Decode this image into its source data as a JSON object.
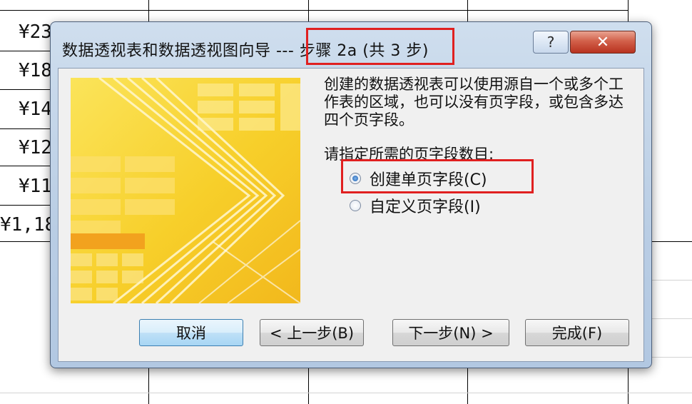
{
  "sheet": {
    "cells": [
      "¥23",
      "¥18",
      "¥14",
      "¥12",
      "¥11",
      "¥1,18"
    ]
  },
  "dialog": {
    "title_prefix": "数据透视表和数据透视图向导 --- ",
    "title_step": "步骤 2a (共 3 步)",
    "help_glyph": "?",
    "close_glyph": "✕",
    "description": "创建的数据透视表可以使用源自一个或多个工作表的区域，也可以没有页字段，或包含多达四个页字段。",
    "prompt": "请指定所需的页字段数目:",
    "options": [
      {
        "label": "创建单页字段(C)",
        "selected": true
      },
      {
        "label": "自定义页字段(I)",
        "selected": false
      }
    ],
    "buttons": {
      "cancel": "取消",
      "back": "< 上一步(B)",
      "next": "下一步(N) >",
      "finish": "完成(F)"
    }
  }
}
